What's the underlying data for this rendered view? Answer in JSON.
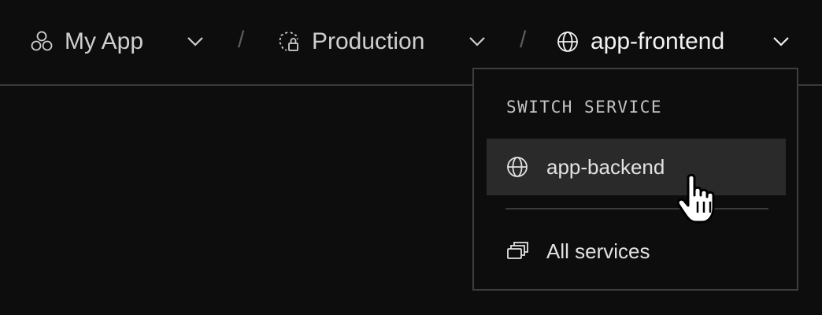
{
  "breadcrumb": {
    "app": {
      "label": "My App",
      "icon": "cubes-icon"
    },
    "environment": {
      "label": "Production",
      "icon": "env-lock-icon"
    },
    "service": {
      "label": "app-frontend",
      "icon": "globe-icon"
    },
    "separator": "/"
  },
  "menu": {
    "title": "SWITCH SERVICE",
    "items": [
      {
        "label": "app-backend",
        "icon": "globe-icon",
        "highlighted": true
      },
      {
        "label": "All services",
        "icon": "stack-windows-icon"
      }
    ]
  },
  "colors": {
    "background": "#0d0d0d",
    "hover": "#2a2a2a",
    "border": "#3e3e3e"
  }
}
